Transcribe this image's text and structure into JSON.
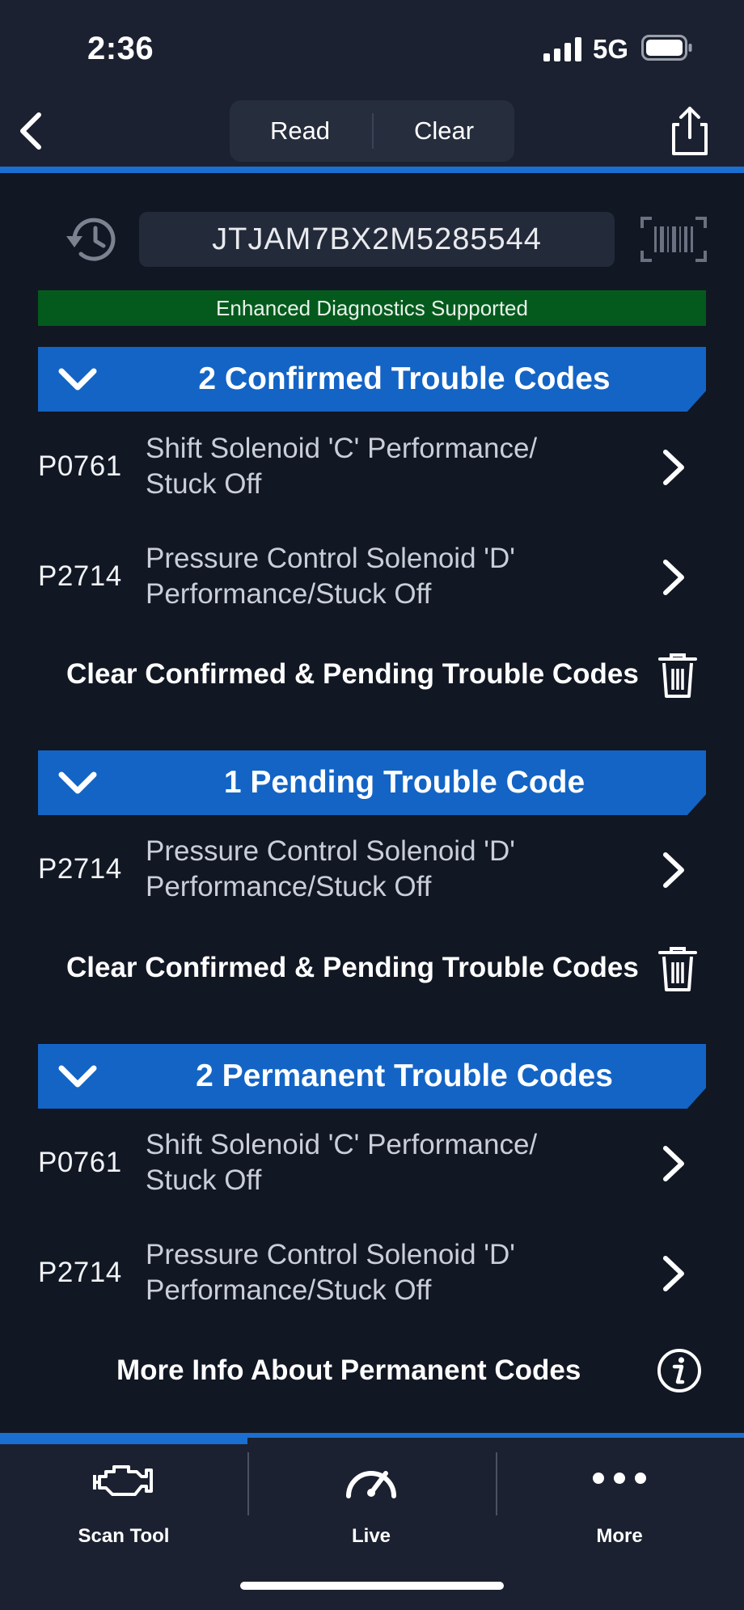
{
  "status_bar": {
    "time": "2:36",
    "network": "5G"
  },
  "nav": {
    "read_label": "Read",
    "clear_label": "Clear"
  },
  "vin": {
    "value": "JTJAM7BX2M5285544"
  },
  "banner": {
    "text": "Enhanced Diagnostics Supported"
  },
  "sections": {
    "confirmed": {
      "title": "2 Confirmed Trouble Codes",
      "codes": [
        {
          "code": "P0761",
          "line1": "Shift Solenoid 'C' Performance/",
          "line2": "Stuck Off"
        },
        {
          "code": "P2714",
          "line1": "Pressure Control Solenoid 'D'",
          "line2": "Performance/Stuck Off"
        }
      ],
      "action": "Clear Confirmed & Pending Trouble Codes"
    },
    "pending": {
      "title": "1 Pending Trouble Code",
      "codes": [
        {
          "code": "P2714",
          "line1": "Pressure Control Solenoid 'D'",
          "line2": "Performance/Stuck Off"
        }
      ],
      "action": "Clear Confirmed & Pending Trouble Codes"
    },
    "permanent": {
      "title": "2 Permanent Trouble Codes",
      "codes": [
        {
          "code": "P0761",
          "line1": "Shift Solenoid 'C' Performance/",
          "line2": "Stuck Off"
        },
        {
          "code": "P2714",
          "line1": "Pressure Control Solenoid 'D'",
          "line2": "Performance/Stuck Off"
        }
      ],
      "action": "More Info About Permanent Codes"
    }
  },
  "tabs": [
    {
      "label": "Scan Tool",
      "icon": "engine-icon",
      "active": true
    },
    {
      "label": "Live",
      "icon": "speedometer-icon",
      "active": false
    },
    {
      "label": "More",
      "icon": "more-dots-icon",
      "active": false
    }
  ],
  "colors": {
    "accent": "#1364c5",
    "banner": "#045a1d",
    "background": "#111723"
  }
}
